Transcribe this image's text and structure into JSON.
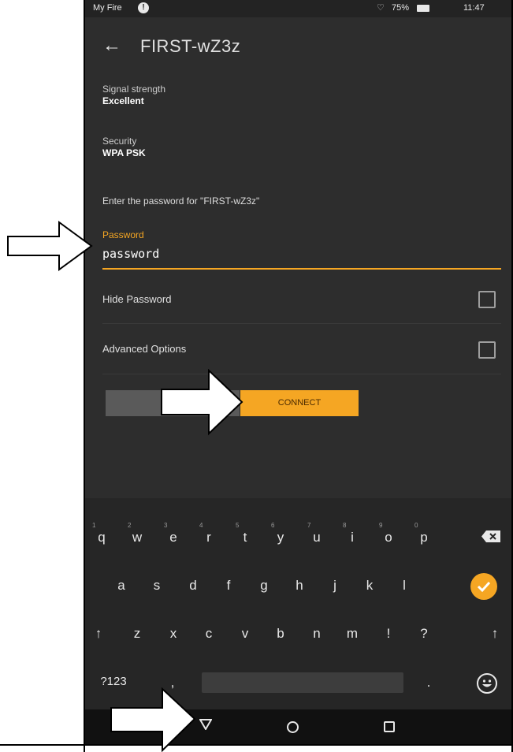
{
  "status_bar": {
    "device_name": "My Fire",
    "alert_icon": "alert-icon",
    "battery_percent": "75%",
    "time": "11:47"
  },
  "header": {
    "back_icon": "arrow-left-icon",
    "title": "FIRST-wZ3z"
  },
  "network": {
    "signal_label": "Signal strength",
    "signal_value": "Excellent",
    "security_label": "Security",
    "security_value": "WPA PSK"
  },
  "password_section": {
    "prompt": "Enter the password for \"FIRST-wZ3z\"",
    "field_label": "Password",
    "field_value": "password"
  },
  "options": {
    "hide_password_label": "Hide Password",
    "hide_password_checked": false,
    "advanced_options_label": "Advanced Options",
    "advanced_options_checked": false
  },
  "buttons": {
    "cancel_label": "CA",
    "connect_label": "CONNECT"
  },
  "keyboard": {
    "row1": [
      "q",
      "w",
      "e",
      "r",
      "t",
      "y",
      "u",
      "i",
      "o",
      "p"
    ],
    "row1_numbers": [
      "1",
      "2",
      "3",
      "4",
      "5",
      "6",
      "7",
      "8",
      "9",
      "0"
    ],
    "row2": [
      "a",
      "s",
      "d",
      "f",
      "g",
      "h",
      "j",
      "k",
      "l"
    ],
    "row3": [
      "↑",
      "z",
      "x",
      "c",
      "v",
      "b",
      "n",
      "m",
      "!",
      "?",
      "↑"
    ],
    "symbols_key": "?123",
    "comma_key": ",",
    "period_key": "."
  },
  "colors": {
    "accent": "#f5a623",
    "screen_bg": "#2d2d2d",
    "keyboard_bg": "#262626"
  }
}
